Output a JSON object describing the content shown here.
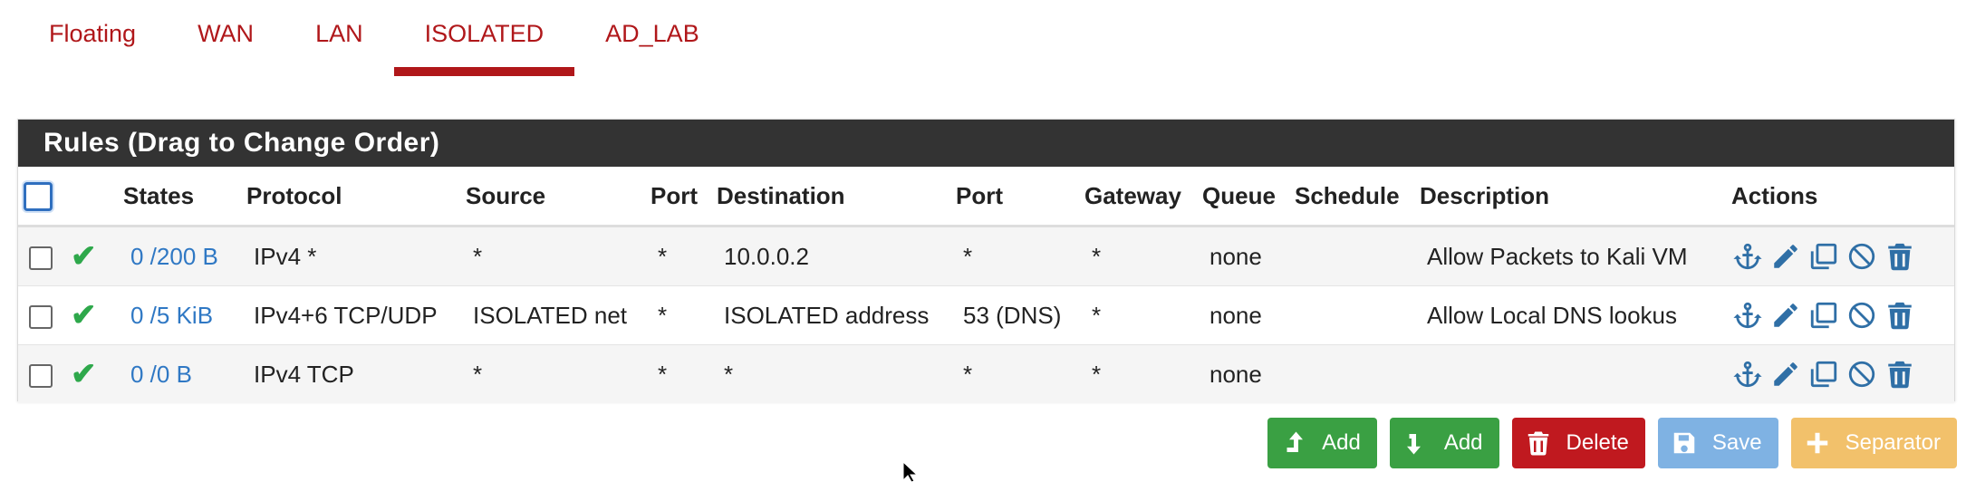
{
  "tabs": [
    {
      "label": "Floating",
      "active": false
    },
    {
      "label": "WAN",
      "active": false
    },
    {
      "label": "LAN",
      "active": false
    },
    {
      "label": "ISOLATED",
      "active": true
    },
    {
      "label": "AD_LAB",
      "active": false
    }
  ],
  "panel": {
    "title": "Rules (Drag to Change Order)"
  },
  "table": {
    "headers": {
      "states": "States",
      "protocol": "Protocol",
      "source": "Source",
      "port": "Port",
      "destination": "Destination",
      "dport": "Port",
      "gateway": "Gateway",
      "queue": "Queue",
      "schedule": "Schedule",
      "description": "Description",
      "actions": "Actions"
    },
    "rows": [
      {
        "states": "0 /200 B",
        "protocol": "IPv4 *",
        "source": "*",
        "port": "*",
        "destination": "10.0.0.2",
        "dport": "*",
        "gateway": "*",
        "queue": "none",
        "schedule": "",
        "description": "Allow Packets to Kali VM"
      },
      {
        "states": "0 /5 KiB",
        "protocol": "IPv4+6 TCP/UDP",
        "source": "ISOLATED net",
        "port": "*",
        "destination": "ISOLATED address",
        "dport": "53 (DNS)",
        "gateway": "*",
        "queue": "none",
        "schedule": "",
        "description": "Allow Local DNS lookus"
      },
      {
        "states": "0 /0 B",
        "protocol": "IPv4 TCP",
        "source": "*",
        "port": "*",
        "destination": "*",
        "dport": "*",
        "gateway": "*",
        "queue": "none",
        "schedule": "",
        "description": ""
      }
    ]
  },
  "buttons": {
    "add_top": "Add",
    "add_bottom": "Add",
    "delete": "Delete",
    "save": "Save",
    "separator": "Separator"
  },
  "colors": {
    "accent": "#b0171a",
    "panel_header": "#333333",
    "link": "#2f78c4",
    "green": "#3aa043",
    "red": "#c0191f",
    "blue": "#7fb2e3",
    "orange": "#f2c16b"
  }
}
